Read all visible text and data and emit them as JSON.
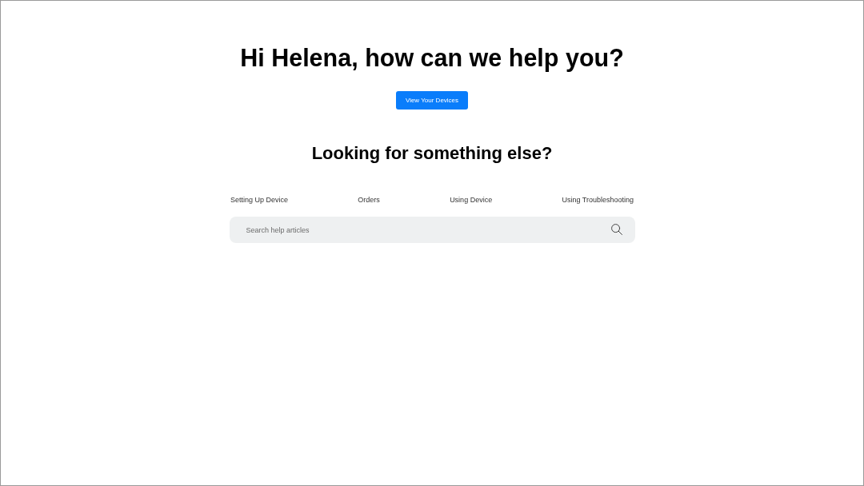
{
  "greeting": {
    "title": "Hi Helena, how can we help you?",
    "button": "View Your Devices"
  },
  "help": {
    "title": "Looking for something else?",
    "topics": [
      "Setting Up Device",
      "Orders",
      "Using Device",
      "Using Troubleshooting"
    ],
    "search": {
      "placeholder": "Search help articles"
    }
  }
}
